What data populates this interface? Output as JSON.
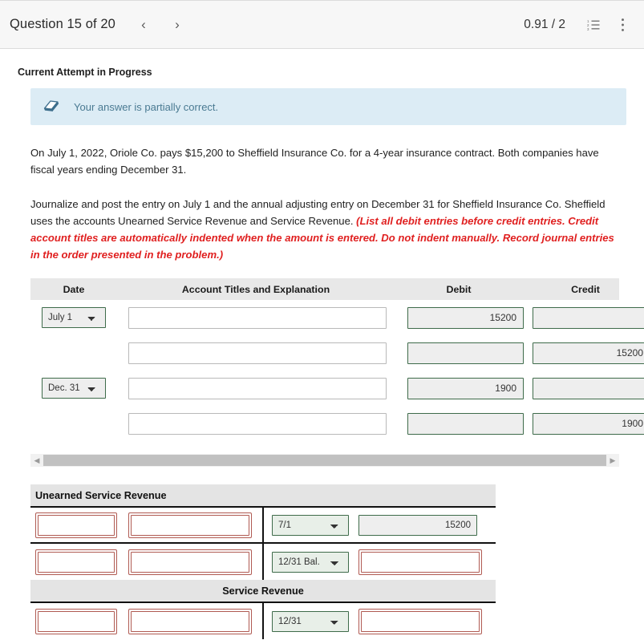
{
  "topbar": {
    "question_label": "Question 15 of 20",
    "prev_arrow": "‹",
    "next_arrow": "›",
    "score": "0.91 / 2",
    "list_icon_name": "numbered-list-icon",
    "menu_icon_name": "kebab-menu-icon",
    "background": "#f7f7f7"
  },
  "attempt": {
    "status": "Current Attempt in Progress"
  },
  "alert": {
    "message": "Your answer is partially correct.",
    "background": "#dcecf5",
    "text_color": "#4a7a92",
    "icon_name": "eraser-icon"
  },
  "problem": {
    "paragraph1": "On July 1, 2022, Oriole Co. pays $15,200 to Sheffield Insurance Co. for a 4-year insurance contract. Both companies have fiscal years ending December 31.",
    "paragraph2_lead": "Journalize and post the entry on July 1 and the annual adjusting entry on December 31 for Sheffield Insurance Co. Sheffield uses the accounts Unearned Service Revenue and Service Revenue. ",
    "paragraph2_instruction": "(List all debit entries before credit entries. Credit account titles are automatically indented when the amount is entered. Do not indent manually. Record journal entries in the order presented in the problem.)",
    "instruction_color": "#e02020"
  },
  "journal": {
    "headers": {
      "date": "Date",
      "account": "Account Titles and Explanation",
      "debit": "Debit",
      "credit": "Credit"
    },
    "rows": [
      {
        "date": "July 1",
        "has_date": true,
        "account": "",
        "account_placeholder": "",
        "debit": "15200",
        "credit": ""
      },
      {
        "date": "",
        "has_date": false,
        "account": "",
        "account_placeholder": "",
        "debit": "",
        "credit": "15200"
      },
      {
        "date": "Dec. 31",
        "has_date": true,
        "account": "",
        "account_placeholder": "",
        "debit": "1900",
        "credit": ""
      },
      {
        "date": "",
        "has_date": false,
        "account": "",
        "account_placeholder": "",
        "debit": "",
        "credit": "1900"
      }
    ]
  },
  "scrollbar": {
    "left_arrow": "◀",
    "right_arrow": "▶"
  },
  "taccounts": [
    {
      "title": "Unearned Service Revenue",
      "title_align": "left",
      "rows": [
        {
          "left_date": "",
          "left_date_error": true,
          "left_amount": "",
          "left_amount_error": true,
          "right_date": "7/1",
          "right_date_error": false,
          "right_amount": "15200",
          "right_amount_error": false
        },
        {
          "left_date": "",
          "left_date_error": true,
          "left_amount": "",
          "left_amount_error": true,
          "right_date": "12/31 Bal.",
          "right_date_error": false,
          "right_amount": "",
          "right_amount_error": true
        }
      ]
    },
    {
      "title": "Service Revenue",
      "title_align": "center",
      "rows": [
        {
          "left_date": "",
          "left_date_error": true,
          "left_amount": "",
          "left_amount_error": true,
          "right_date": "12/31",
          "right_date_error": false,
          "right_amount": "",
          "right_amount_error": true
        }
      ]
    }
  ],
  "colors": {
    "field_border_ok": "#3e6b4a",
    "field_border_error": "#b05a52",
    "header_bg": "#e8e8e8",
    "taccount_header_bg": "#e4e4e4"
  }
}
